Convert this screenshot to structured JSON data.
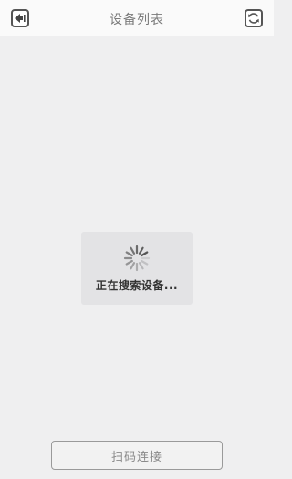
{
  "header": {
    "title": "设备列表",
    "back_icon": "back-arrow-icon",
    "refresh_icon": "refresh-icon"
  },
  "loading": {
    "text": "正在搜索设备...",
    "icon": "spinner-icon"
  },
  "footer": {
    "scan_button_label": "扫码连接"
  },
  "colors": {
    "background": "#efeff0",
    "navbar": "#fafafa",
    "loading_box": "#e3e3e5"
  }
}
